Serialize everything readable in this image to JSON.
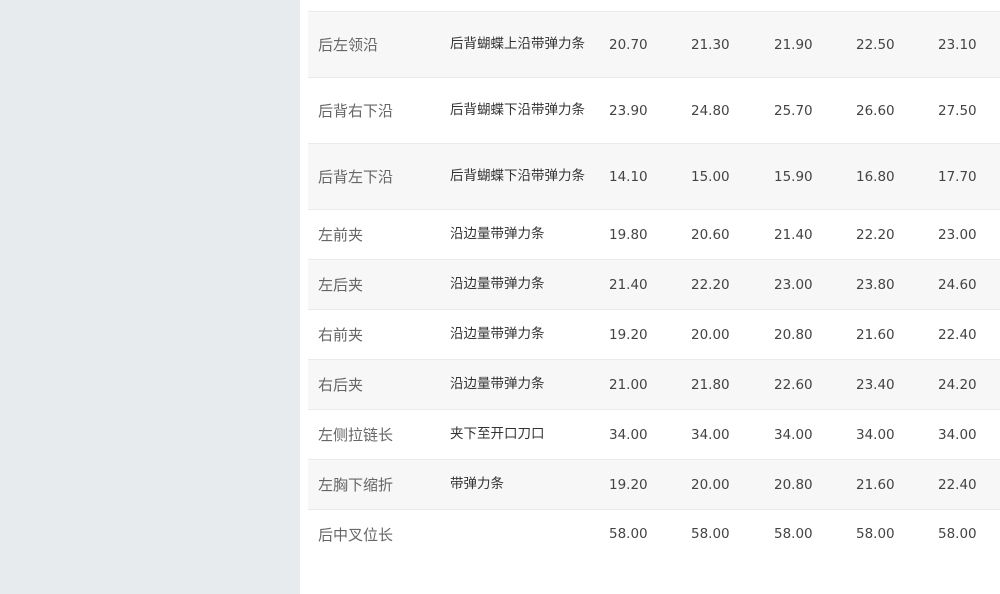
{
  "table": {
    "rows": [
      {
        "part": "后左领沿",
        "method": "后背蝴蝶上沿带弹力条",
        "values": [
          "20.70",
          "21.30",
          "21.90",
          "22.50",
          "23.10"
        ]
      },
      {
        "part": "后背右下沿",
        "method": "后背蝴蝶下沿带弹力条",
        "values": [
          "23.90",
          "24.80",
          "25.70",
          "26.60",
          "27.50"
        ]
      },
      {
        "part": "后背左下沿",
        "method": "后背蝴蝶下沿带弹力条",
        "values": [
          "14.10",
          "15.00",
          "15.90",
          "16.80",
          "17.70"
        ]
      },
      {
        "part": "左前夹",
        "method": "沿边量带弹力条",
        "values": [
          "19.80",
          "20.60",
          "21.40",
          "22.20",
          "23.00"
        ]
      },
      {
        "part": "左后夹",
        "method": "沿边量带弹力条",
        "values": [
          "21.40",
          "22.20",
          "23.00",
          "23.80",
          "24.60"
        ]
      },
      {
        "part": "右前夹",
        "method": "沿边量带弹力条",
        "values": [
          "19.20",
          "20.00",
          "20.80",
          "21.60",
          "22.40"
        ]
      },
      {
        "part": "右后夹",
        "method": "沿边量带弹力条",
        "values": [
          "21.00",
          "21.80",
          "22.60",
          "23.40",
          "24.20"
        ]
      },
      {
        "part": "左侧拉链长",
        "method": "夹下至开口刀口",
        "values": [
          "34.00",
          "34.00",
          "34.00",
          "34.00",
          "34.00"
        ]
      },
      {
        "part": "左胸下缩折",
        "method": "带弹力条",
        "values": [
          "19.20",
          "20.00",
          "20.80",
          "21.60",
          "22.40"
        ]
      },
      {
        "part": "后中叉位长",
        "method": "",
        "values": [
          "58.00",
          "58.00",
          "58.00",
          "58.00",
          "58.00"
        ]
      }
    ]
  }
}
